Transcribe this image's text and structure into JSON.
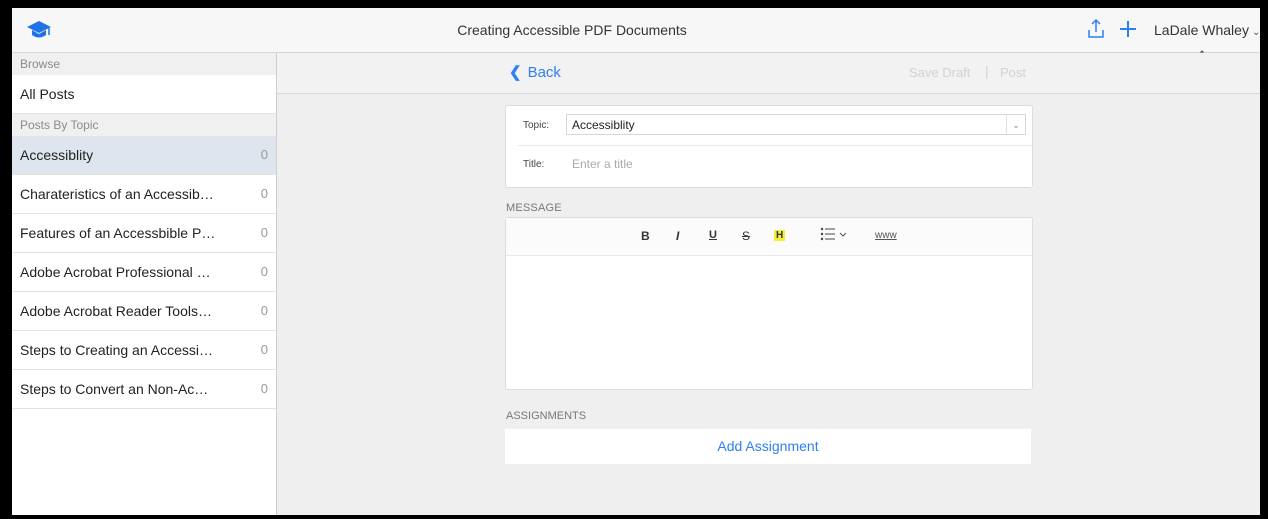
{
  "header": {
    "title": "Creating Accessible PDF Documents",
    "user_name": "LaDale Whaley",
    "logo_icon": "graduation-cap-icon",
    "accent_color": "#2d7ff3"
  },
  "sidebar": {
    "browse_header": "Browse",
    "all_posts": "All Posts",
    "topics_header": "Posts By Topic",
    "items": [
      {
        "label": "Accessiblity",
        "count": "0",
        "active": true
      },
      {
        "label": "Charateristics of an Accessib…",
        "count": "0"
      },
      {
        "label": "Features of an Accessbible P…",
        "count": "0"
      },
      {
        "label": "Adobe Acrobat Professional …",
        "count": "0"
      },
      {
        "label": "Adobe Acrobat Reader Tools…",
        "count": "0"
      },
      {
        "label": "Steps to Creating an Accessi…",
        "count": "0"
      },
      {
        "label": "Steps to Convert an Non-Ac…",
        "count": "0"
      }
    ]
  },
  "subbar": {
    "back_label": "Back",
    "save_draft_label": "Save Draft",
    "divider": "|",
    "post_label": "Post"
  },
  "form": {
    "topic_label": "Topic:",
    "topic_value": "Accessiblity",
    "title_label": "Title:",
    "title_placeholder": "Enter a title"
  },
  "editor": {
    "message_label": "MESSAGE",
    "toolbar": {
      "bold": "B",
      "italic": "I",
      "underline": "U",
      "strike": "S",
      "highlight": "H",
      "link": "www"
    }
  },
  "assignments": {
    "label": "ASSIGNMENTS",
    "add_label": "Add Assignment"
  }
}
